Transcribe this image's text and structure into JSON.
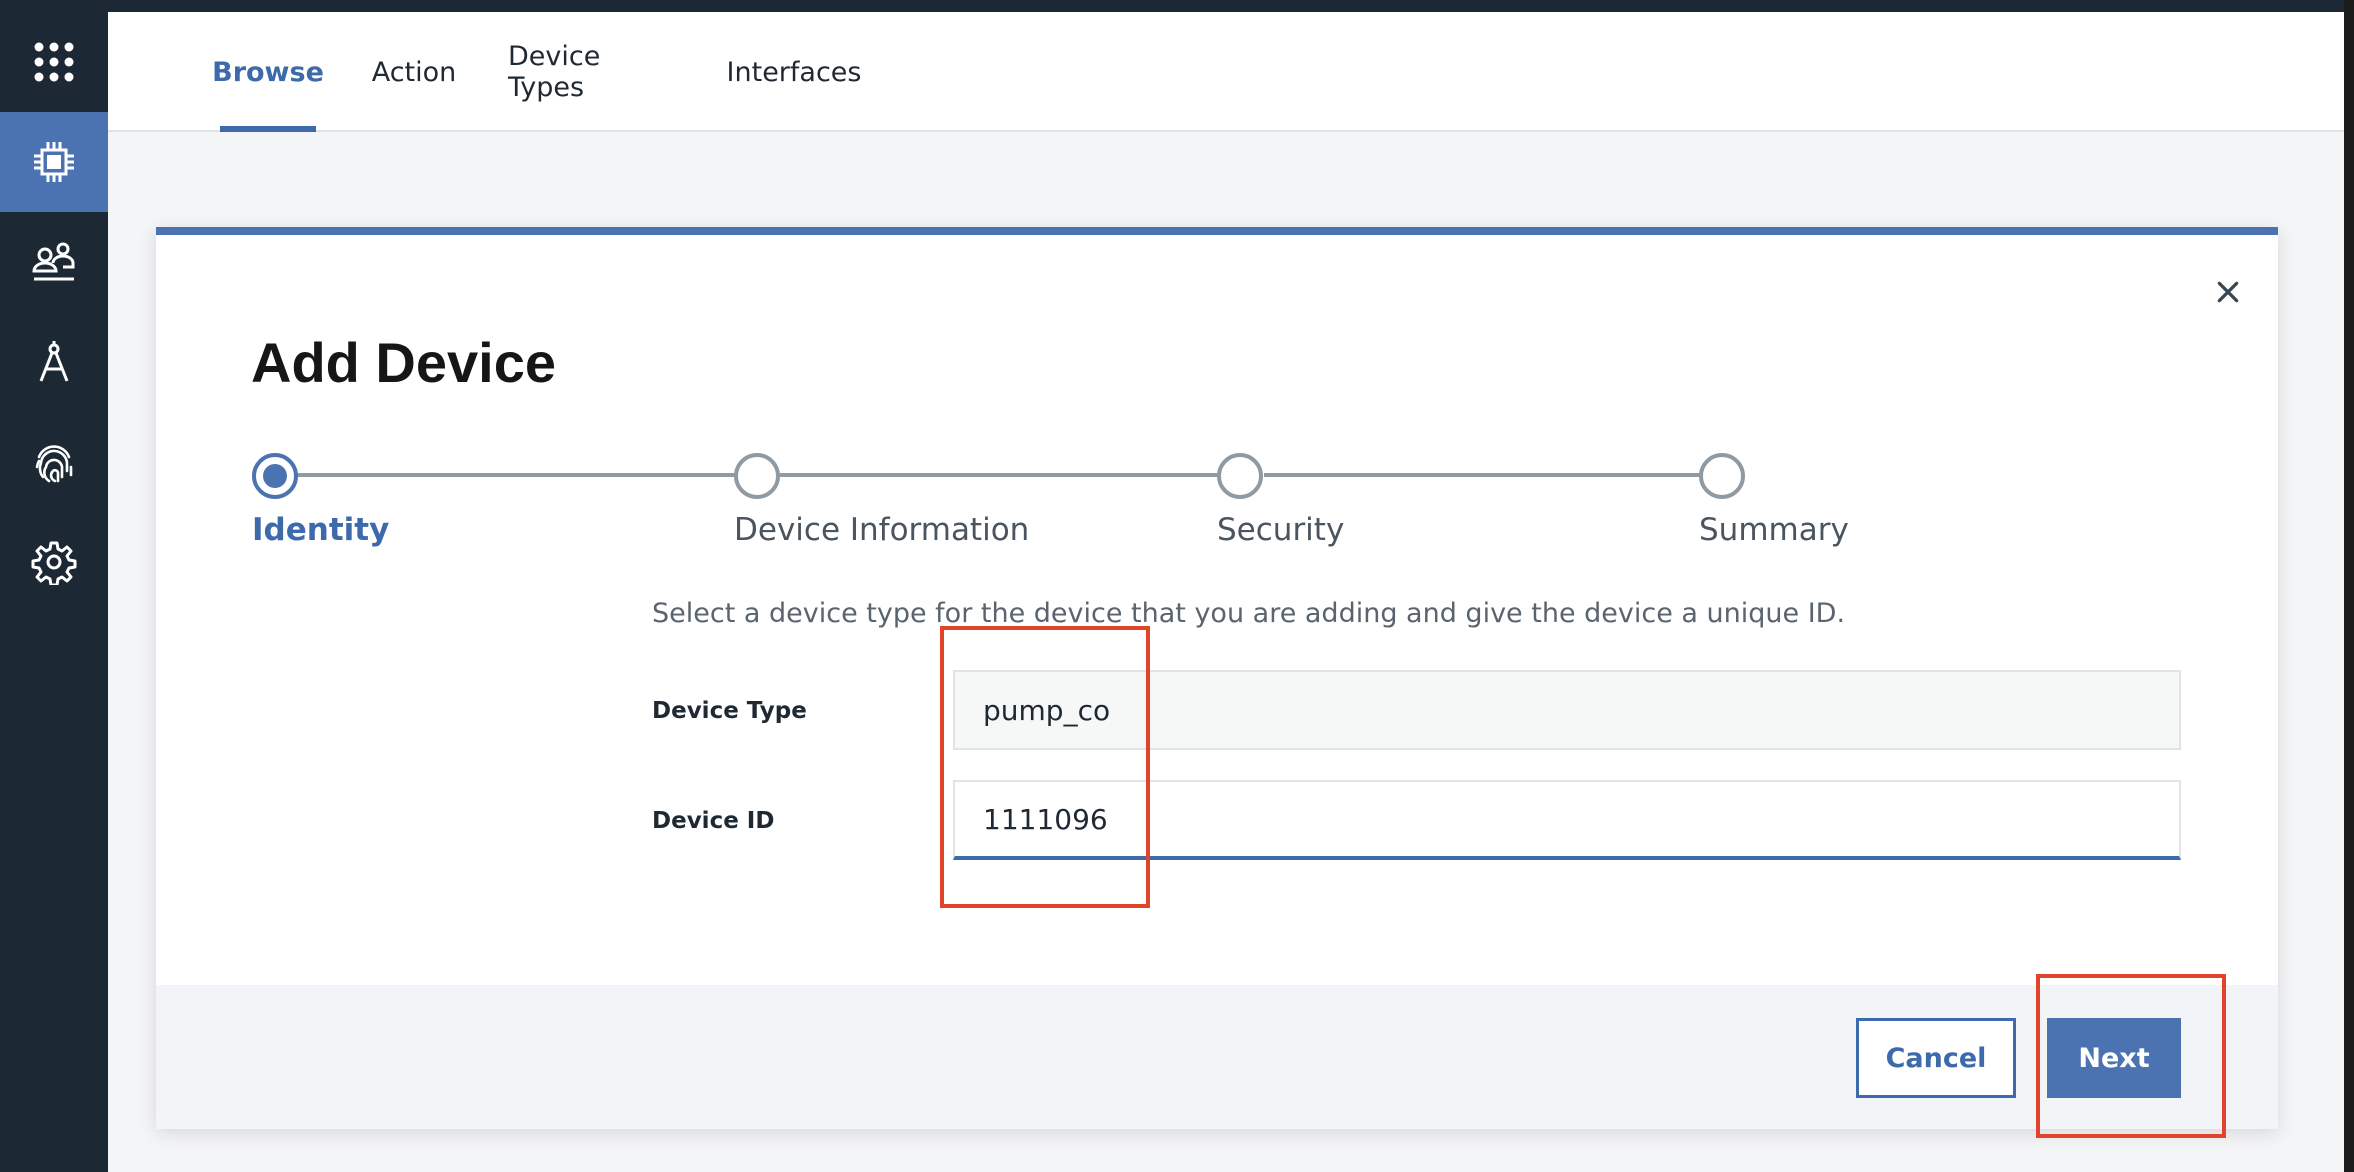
{
  "colors": {
    "accent": "#4b73b2",
    "accent_dark": "#3d6aab",
    "sidebar_bg": "#1c2833",
    "annotation": "#e0442b"
  },
  "sidebar": {
    "items": [
      {
        "icon": "app-grid-icon",
        "active": false
      },
      {
        "icon": "chip-icon",
        "active": true
      },
      {
        "icon": "members-icon",
        "active": false
      },
      {
        "icon": "compass-icon",
        "active": false
      },
      {
        "icon": "fingerprint-icon",
        "active": false
      },
      {
        "icon": "gear-icon",
        "active": false
      }
    ]
  },
  "header": {
    "tabs": [
      {
        "label": "Browse",
        "active": true
      },
      {
        "label": "Action",
        "active": false
      },
      {
        "label": "Device Types",
        "active": false
      },
      {
        "label": "Interfaces",
        "active": false
      }
    ]
  },
  "modal": {
    "title": "Add Device",
    "close_icon": "close-icon",
    "steps": [
      {
        "label": "Identity",
        "active": true
      },
      {
        "label": "Device Information",
        "active": false
      },
      {
        "label": "Security",
        "active": false
      },
      {
        "label": "Summary",
        "active": false
      }
    ],
    "description": "Select a device type for the device that you are adding and give the device a unique ID.",
    "fields": {
      "device_type": {
        "label": "Device Type",
        "value": "pump_co"
      },
      "device_id": {
        "label": "Device ID",
        "value": "1111096"
      }
    },
    "buttons": {
      "cancel": "Cancel",
      "next": "Next"
    }
  }
}
